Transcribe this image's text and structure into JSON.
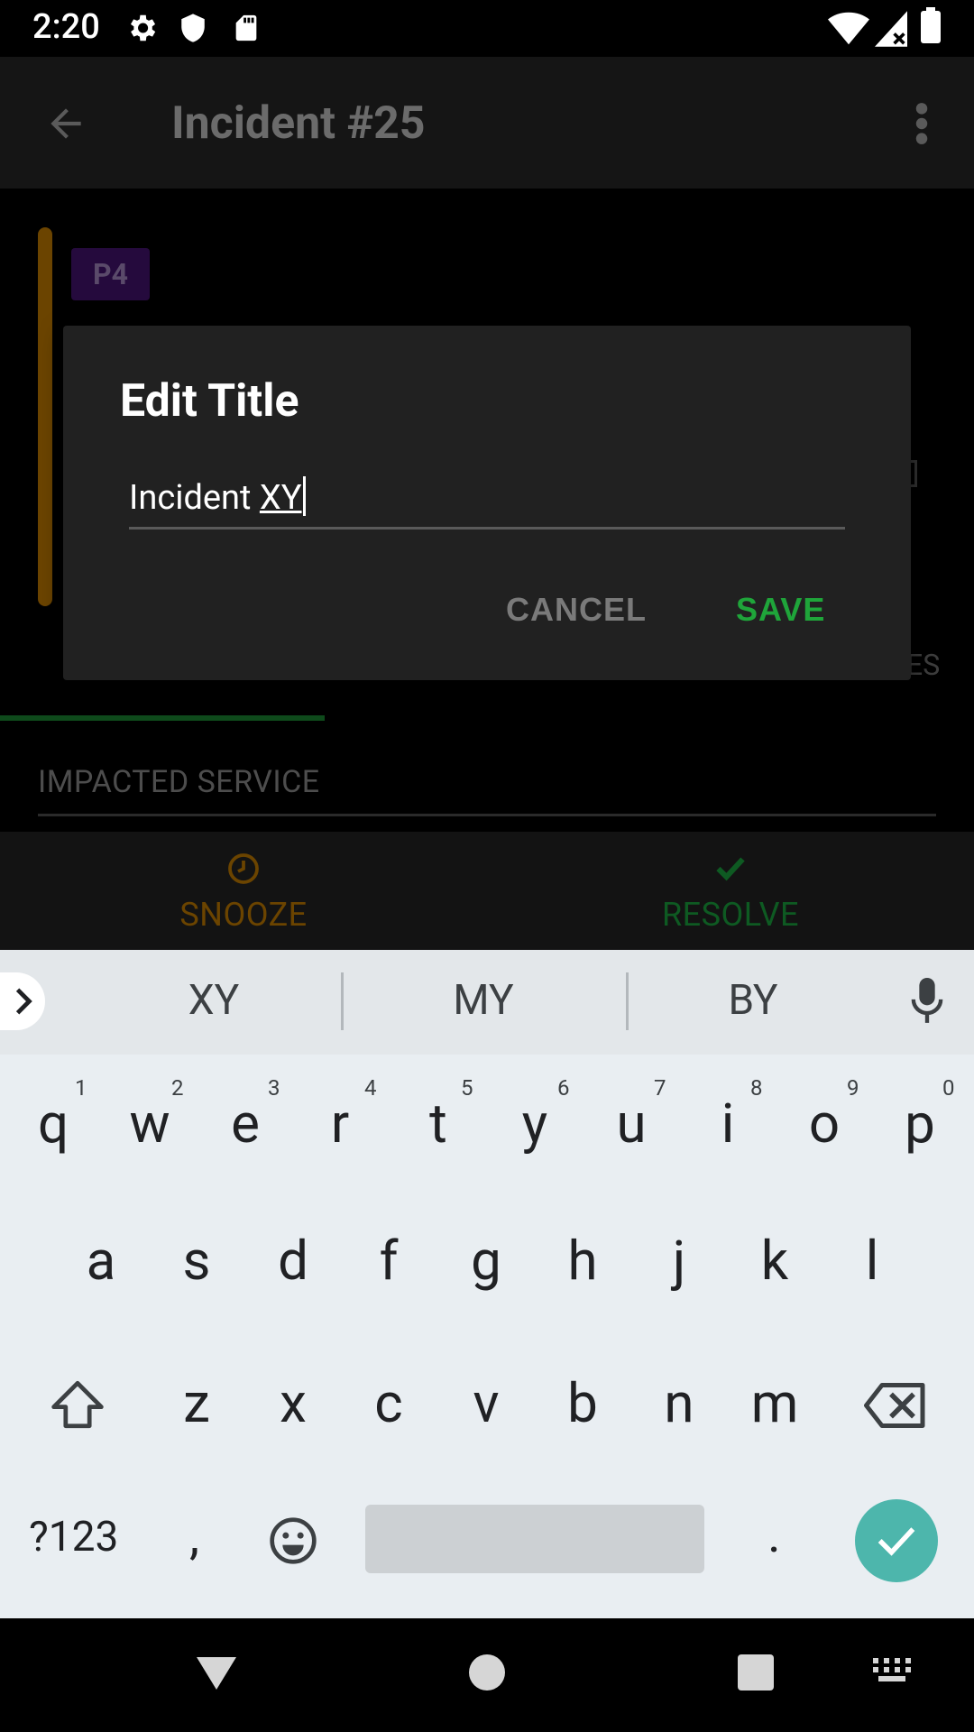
{
  "status_bar": {
    "time": "2:20",
    "icons": [
      "gear-icon",
      "shield-icon",
      "sd-card-icon"
    ],
    "right_icons": [
      "wifi-icon",
      "cell-signal-icon",
      "battery-icon"
    ]
  },
  "app_bar": {
    "title": "Incident #25",
    "back_icon": "arrow-back-icon",
    "menu_icon": "more-vert-icon"
  },
  "incident": {
    "priority": "P4",
    "impacted_service_label": "IMPACTED SERVICE",
    "obscured_text": "ES"
  },
  "actions": {
    "snooze": "SNOOZE",
    "resolve": "RESOLVE"
  },
  "dialog": {
    "title": "Edit Title",
    "input_prefix": "Incident ",
    "input_word": "XY",
    "input_value": "Incident XY",
    "cancel": "CANCEL",
    "save": "SAVE"
  },
  "keyboard": {
    "suggestions": [
      "XY",
      "MY",
      "BY"
    ],
    "row1": [
      "q",
      "w",
      "e",
      "r",
      "t",
      "y",
      "u",
      "i",
      "o",
      "p"
    ],
    "row1_hints": [
      "1",
      "2",
      "3",
      "4",
      "5",
      "6",
      "7",
      "8",
      "9",
      "0"
    ],
    "row2": [
      "a",
      "s",
      "d",
      "f",
      "g",
      "h",
      "j",
      "k",
      "l"
    ],
    "row3": [
      "z",
      "x",
      "c",
      "v",
      "b",
      "n",
      "m"
    ],
    "symbols": "?123",
    "comma": ",",
    "period": "."
  },
  "colors": {
    "save_green": "#1fa53a",
    "snooze_orange": "#7a4d00",
    "resolve_green": "#0e5a22",
    "enter_teal": "#4db6ac"
  }
}
